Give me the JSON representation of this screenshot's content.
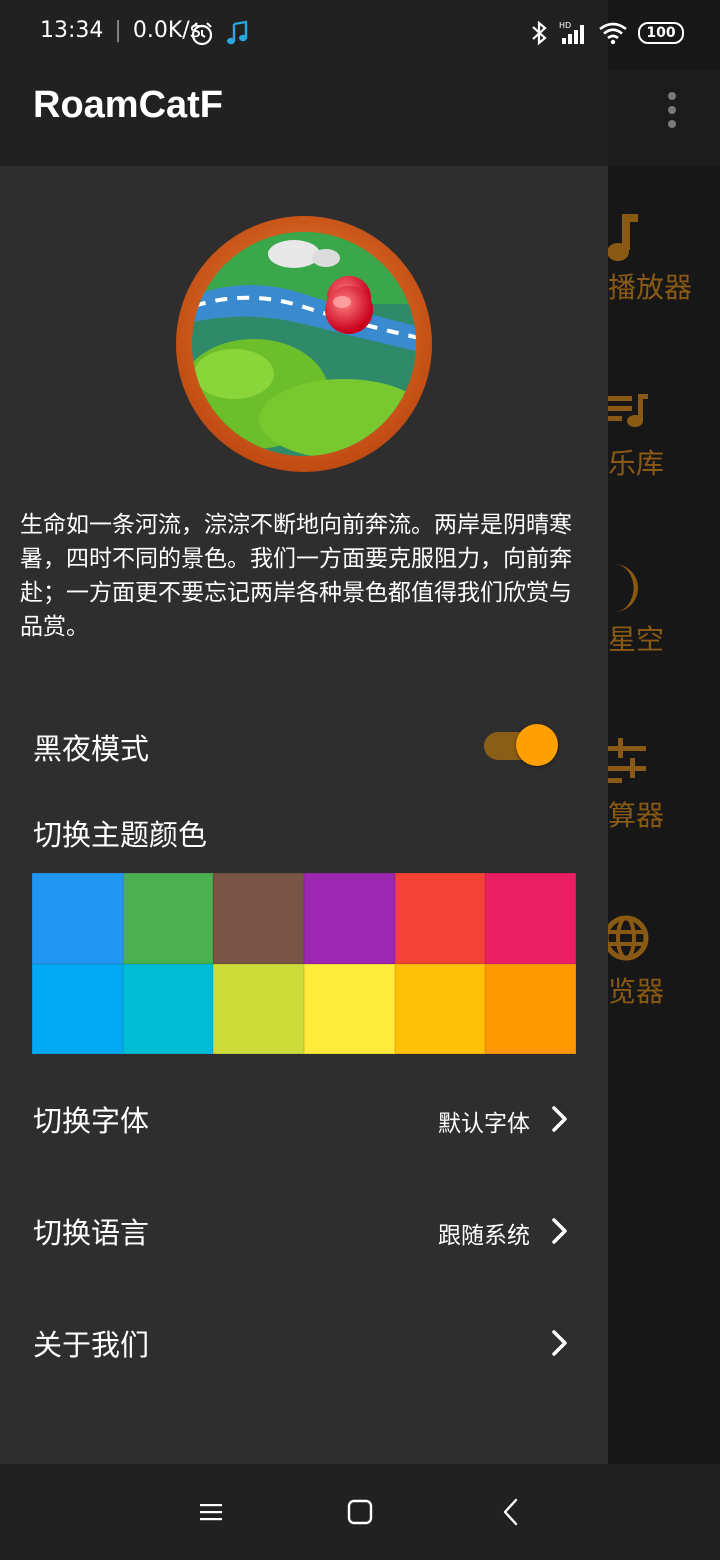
{
  "status_bar": {
    "time": "13:34",
    "net_speed": "0.0K/s",
    "battery": "100",
    "icons": [
      "alarm-icon",
      "music-note-icon",
      "bluetooth-icon",
      "hd-signal-icon",
      "wifi-icon",
      "battery-icon"
    ]
  },
  "background": {
    "menu_icon": "more-vert-icon",
    "nav_items": [
      {
        "label": "播放器",
        "icon": "music-note-icon"
      },
      {
        "label": "乐库",
        "icon": "playlist-icon"
      },
      {
        "label": "星空",
        "icon": "moon-icon"
      },
      {
        "label": "算器",
        "icon": "calculator-icon"
      },
      {
        "label": "览器",
        "icon": "globe-icon"
      }
    ]
  },
  "drawer": {
    "title": "RoamCatF",
    "logo": "river-landscape-logo",
    "motto": "生命如一条河流，淙淙不断地向前奔流。两岸是阴晴寒暑，四时不同的景色。我们一方面要克服阻力，向前奔赴；一方面更不要忘记两岸各种景色都值得我们欣赏与品赏。",
    "night_mode": {
      "label": "黑夜模式",
      "enabled": true
    },
    "theme": {
      "label": "切换主题颜色",
      "colors": [
        "#2196F3",
        "#4CAF50",
        "#795548",
        "#9C27B0",
        "#F44336",
        "#E91E63",
        "#03A9F4",
        "#00BCD4",
        "#CDDC39",
        "#FFEB3B",
        "#FFC107",
        "#FF9800"
      ]
    },
    "font": {
      "label": "切换字体",
      "value": "默认字体"
    },
    "language": {
      "label": "切换语言",
      "value": "跟随系统"
    },
    "about": {
      "label": "关于我们"
    }
  },
  "accent_color": "#FF9F00",
  "nav_bar": {
    "icons": [
      "menu-icon",
      "home-icon",
      "back-icon"
    ]
  }
}
